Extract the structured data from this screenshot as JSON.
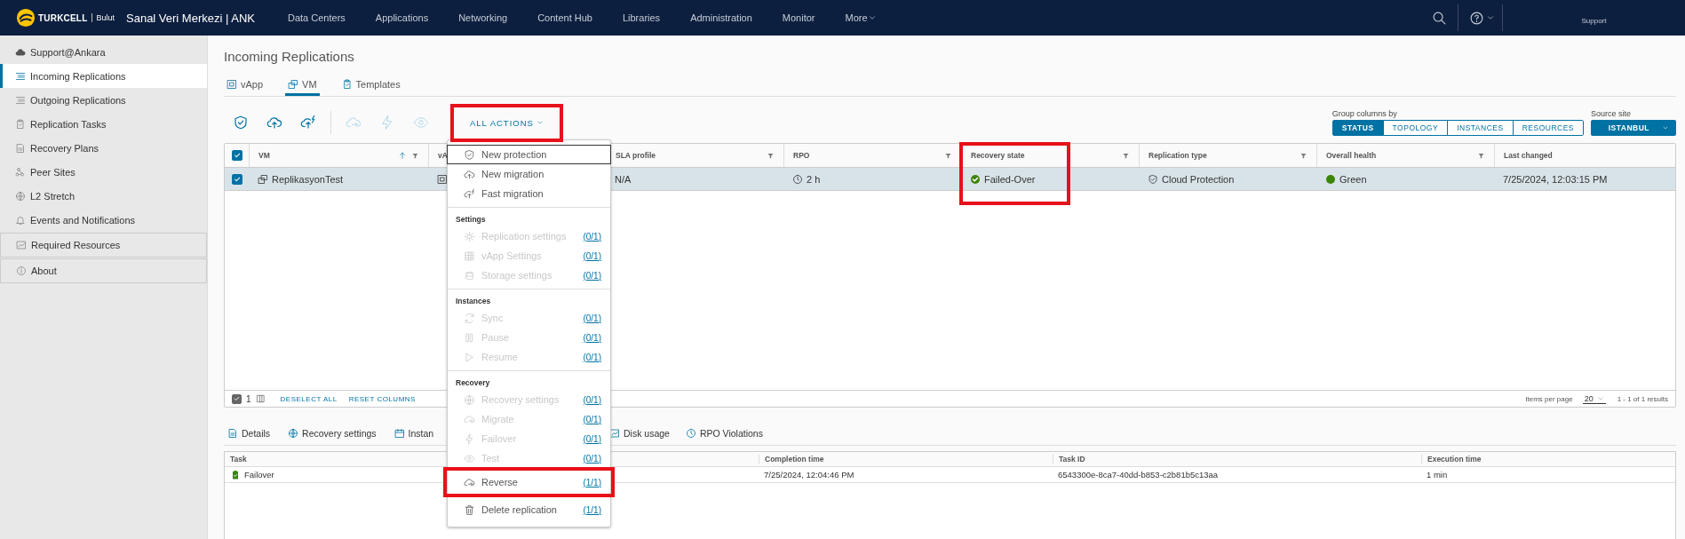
{
  "top_bar": {
    "brand": "TURKCELL",
    "product": "Bulut",
    "title": "Sanal Veri Merkezi | ANK",
    "user": "Support",
    "nav": [
      {
        "label": "Data Centers",
        "kind": "link"
      },
      {
        "label": "Applications",
        "kind": "link"
      },
      {
        "label": "Networking",
        "kind": "link"
      },
      {
        "label": "Content Hub",
        "kind": "link"
      },
      {
        "label": "Libraries",
        "kind": "link"
      },
      {
        "label": "Administration",
        "kind": "link"
      },
      {
        "label": "Monitor",
        "kind": "link"
      },
      {
        "label": "More",
        "kind": "menu"
      }
    ]
  },
  "sidebar": {
    "header": "Support@Ankara",
    "items": [
      {
        "label": "Incoming Replications",
        "selected": true,
        "kind": "nav"
      },
      {
        "label": "Outgoing Replications",
        "selected": false,
        "kind": "nav"
      },
      {
        "label": "Replication Tasks",
        "selected": false,
        "kind": "nav"
      },
      {
        "label": "Recovery Plans",
        "selected": false,
        "kind": "nav"
      },
      {
        "label": "Peer Sites",
        "selected": false,
        "kind": "nav"
      },
      {
        "label": "L2 Stretch",
        "selected": false,
        "kind": "nav"
      },
      {
        "label": "Events and Notifications",
        "selected": false,
        "kind": "nav"
      },
      {
        "label": "Required Resources",
        "selected": false,
        "kind": "boxed"
      },
      {
        "label": "About",
        "selected": false,
        "kind": "boxed"
      }
    ]
  },
  "page_title": "Incoming Replications",
  "view_tabs": [
    {
      "label": "vApp",
      "selected": false
    },
    {
      "label": "VM",
      "selected": true
    },
    {
      "label": "Templates",
      "selected": false
    }
  ],
  "toolbar": {
    "actions": [
      {
        "disabled": false
      },
      {
        "disabled": false
      },
      {
        "disabled": false
      },
      {
        "disabled": true
      },
      {
        "disabled": true
      },
      {
        "disabled": true
      }
    ],
    "all_actions": {
      "label": "ALL ACTIONS",
      "highlighted": true
    }
  },
  "group_by": {
    "label": "Group columns by",
    "options": [
      {
        "label": "STATUS",
        "selected": true
      },
      {
        "label": "TOPOLOGY",
        "selected": false
      },
      {
        "label": "INSTANCES",
        "selected": false
      },
      {
        "label": "RESOURCES",
        "selected": false
      }
    ]
  },
  "source_site": {
    "label": "Source site",
    "value": "ISTANBUL"
  },
  "table": {
    "all_selected": true,
    "sorted_ascending": true,
    "columns": [
      {
        "label": "VM",
        "highlighted": false
      },
      {
        "label": "vA",
        "highlighted": false
      },
      {
        "label": "SLA profile",
        "highlighted": false
      },
      {
        "label": "RPO",
        "highlighted": false
      },
      {
        "label": "Recovery state",
        "highlighted": true
      },
      {
        "label": "Replication type",
        "highlighted": false
      },
      {
        "label": "Overall health",
        "highlighted": false
      },
      {
        "label": "Last changed",
        "highlighted": false
      }
    ],
    "rows": [
      {
        "selected": true,
        "vm": "ReplikasyonTest",
        "sla_profile": "N/A",
        "rpo": "2 h",
        "recovery_state": "Failed-Over",
        "replication_type": "Cloud Protection",
        "overall_health": "Green",
        "last_changed": "7/25/2024, 12:03:15 PM"
      }
    ],
    "footer": {
      "selection_checked": true,
      "selected_count": "1",
      "buttons": [
        "DESELECT ALL",
        "RESET COLUMNS"
      ],
      "items_per_page_label": "Items per page",
      "items_per_page": "20",
      "results": "1 - 1 of 1 results"
    }
  },
  "detail_tabs": [
    {
      "label": "Details"
    },
    {
      "label": "Recovery settings"
    },
    {
      "label": "Instan"
    },
    {
      "label": "Disk usage"
    },
    {
      "label": "RPO Violations"
    }
  ],
  "tasks_table": {
    "columns": [
      "Task",
      "Completion time",
      "Task ID",
      "Execution time"
    ],
    "rows": [
      {
        "task": "Failover",
        "completion_time": "7/25/2024, 12:04:46 PM",
        "task_id": "6543300e-8ca7-40dd-b853-c2b81b5c13aa",
        "execution_time": "1 min"
      }
    ]
  },
  "actions_menu": {
    "groups": [
      {
        "items": [
          {
            "label": "New protection",
            "disabled": false,
            "focused": true,
            "highlighted": false
          },
          {
            "label": "New migration",
            "disabled": false,
            "focused": false,
            "highlighted": false
          },
          {
            "label": "Fast migration",
            "disabled": false,
            "focused": false,
            "highlighted": false
          }
        ]
      },
      {
        "header": "Settings",
        "items": [
          {
            "label": "Replication settings",
            "count": "(0/1)",
            "disabled": true,
            "focused": false,
            "highlighted": false
          },
          {
            "label": "vApp Settings",
            "count": "(0/1)",
            "disabled": true,
            "focused": false,
            "highlighted": false
          },
          {
            "label": "Storage settings",
            "count": "(0/1)",
            "disabled": true,
            "focused": false,
            "highlighted": false
          }
        ]
      },
      {
        "header": "Instances",
        "items": [
          {
            "label": "Sync",
            "count": "(0/1)",
            "disabled": true,
            "focused": false,
            "highlighted": false
          },
          {
            "label": "Pause",
            "count": "(0/1)",
            "disabled": true,
            "focused": false,
            "highlighted": false
          },
          {
            "label": "Resume",
            "count": "(0/1)",
            "disabled": true,
            "focused": false,
            "highlighted": false
          }
        ]
      },
      {
        "header": "Recovery",
        "items": [
          {
            "label": "Recovery settings",
            "count": "(0/1)",
            "disabled": true,
            "focused": false,
            "highlighted": false
          },
          {
            "label": "Migrate",
            "count": "(0/1)",
            "disabled": true,
            "focused": false,
            "highlighted": false
          },
          {
            "label": "Failover",
            "count": "(0/1)",
            "disabled": true,
            "focused": false,
            "highlighted": false
          },
          {
            "label": "Test",
            "count": "(0/1)",
            "disabled": true,
            "focused": false,
            "highlighted": false
          },
          {
            "label": "Reverse",
            "count": "(1/1)",
            "disabled": false,
            "focused": false,
            "highlighted": true
          }
        ]
      },
      {
        "items": [
          {
            "label": "Delete replication",
            "count": "(1/1)",
            "disabled": false,
            "focused": false,
            "highlighted": false
          }
        ]
      }
    ]
  }
}
